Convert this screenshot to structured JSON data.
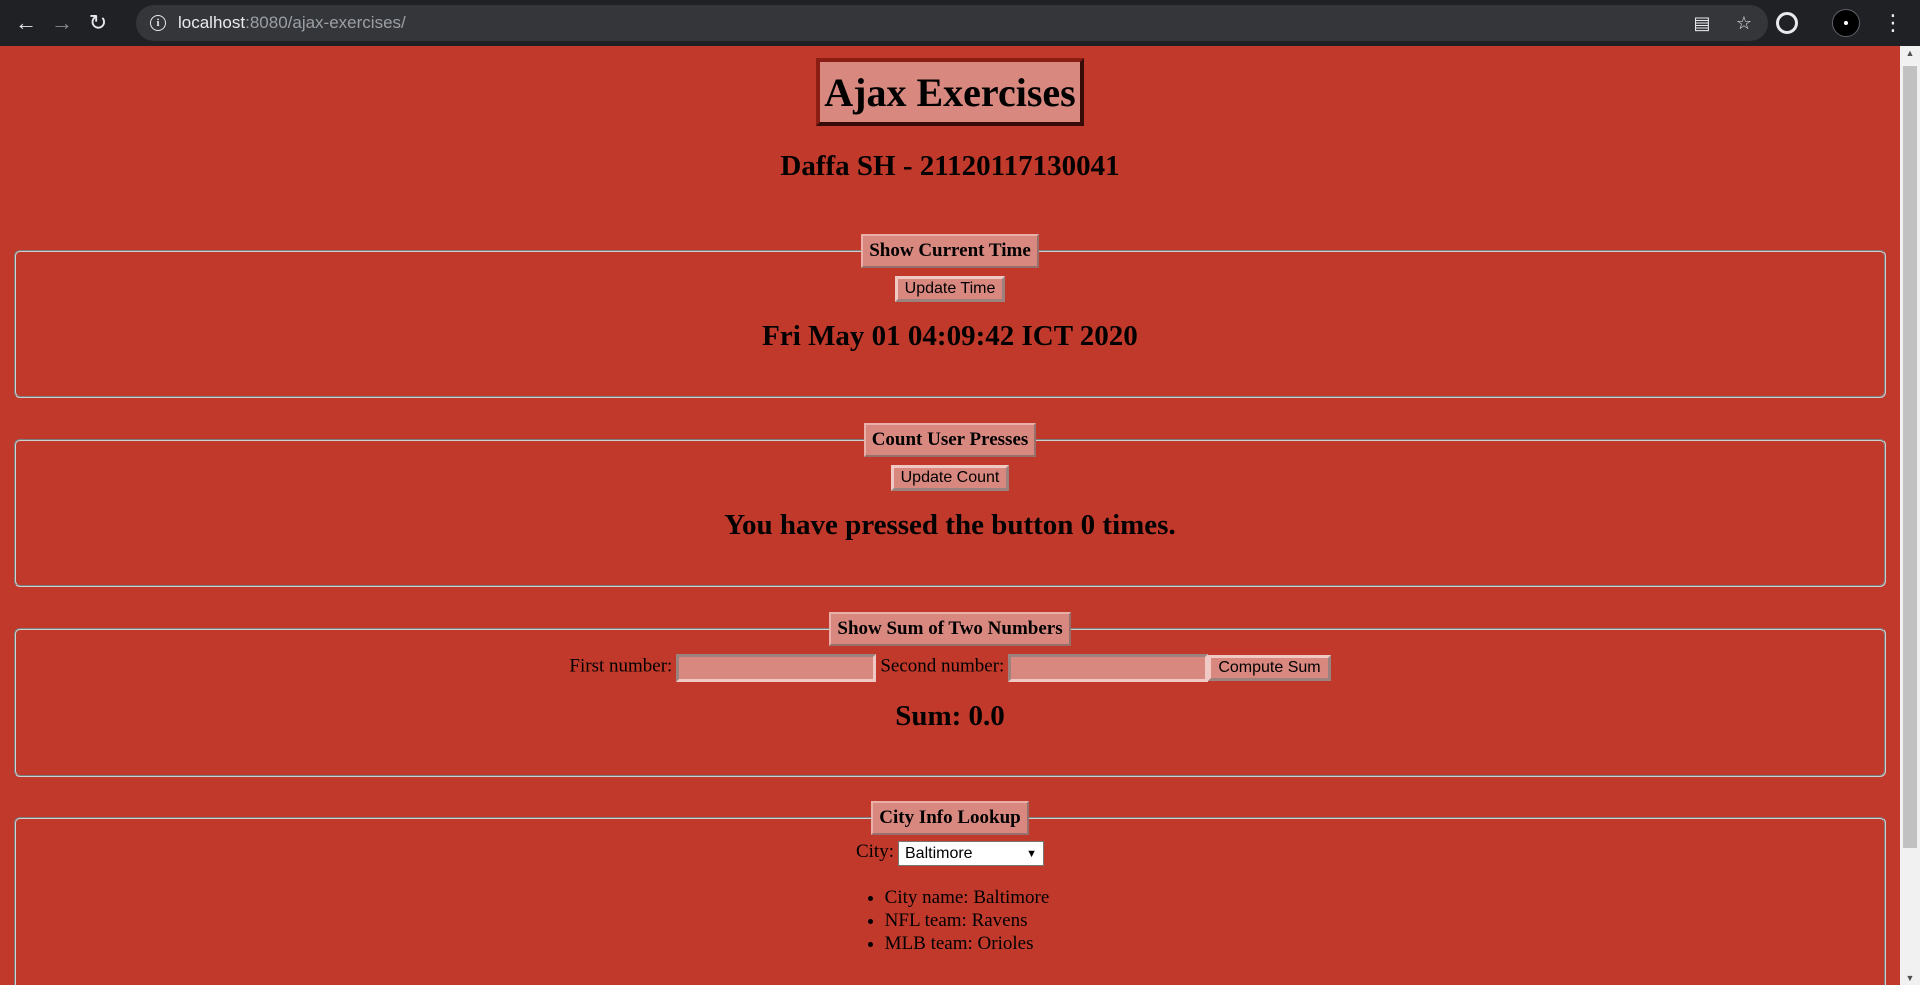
{
  "browser": {
    "url_host": "localhost",
    "url_rest": ":8080/ajax-exercises/"
  },
  "header": {
    "title": "Ajax Exercises",
    "subtitle": "Daffa SH - 21120117130041"
  },
  "time_panel": {
    "legend": "Show Current Time",
    "button_label": "Update Time",
    "result": "Fri May 01 04:09:42 ICT 2020"
  },
  "count_panel": {
    "legend": "Count User Presses",
    "button_label": "Update Count",
    "result": "You have pressed the button 0 times."
  },
  "sum_panel": {
    "legend": "Show Sum of Two Numbers",
    "first_label": "First number:",
    "first_value": "",
    "second_label": "Second number:",
    "second_value": "",
    "button_label": "Compute Sum",
    "result": "Sum: 0.0"
  },
  "city_panel": {
    "legend": "City Info Lookup",
    "city_label": "City:",
    "selected_city": "Baltimore",
    "info": [
      "City name: Baltimore",
      "NFL team: Ravens",
      "MLB team: Orioles"
    ]
  },
  "colors": {
    "page_background": "#c0392b",
    "box_background": "#d98880"
  }
}
